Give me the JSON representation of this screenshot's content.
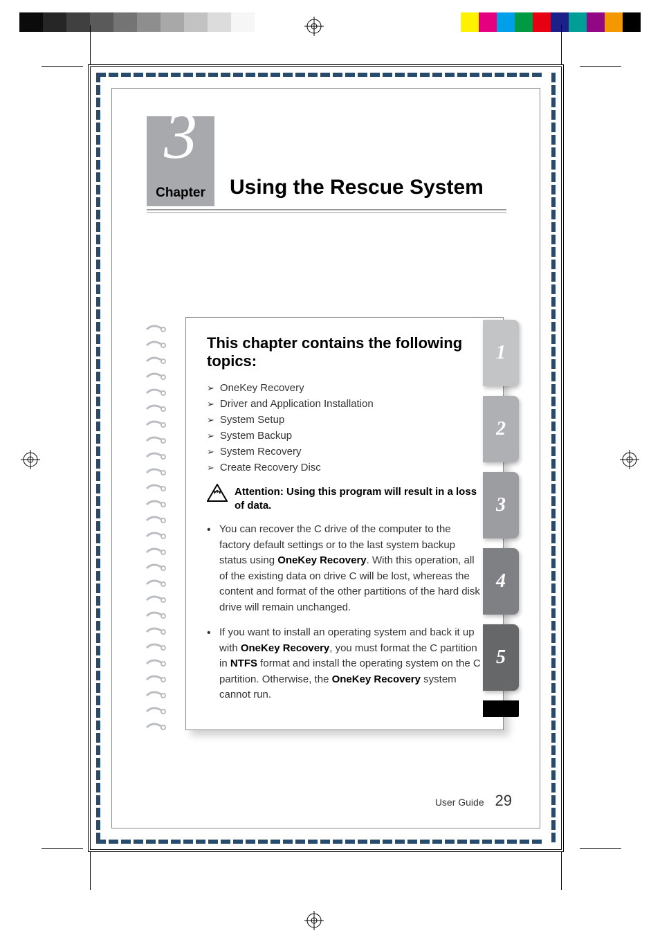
{
  "colorbars_left": [
    "#0b0b0b",
    "#262626",
    "#404040",
    "#5a5a5a",
    "#747474",
    "#8e8e8e",
    "#a8a8a8",
    "#c2c2c2",
    "#dcdcdc",
    "#f6f6f6"
  ],
  "colorbars_right": [
    "#fff200",
    "#e4007f",
    "#00a0e9",
    "#009944",
    "#e60012",
    "#1d2088",
    "#009e96",
    "#920783",
    "#f39800",
    "#000000"
  ],
  "chapter": {
    "number": "3",
    "label": "Chapter",
    "title": "Using the Rescue System"
  },
  "topics": {
    "heading": "This chapter contains the following topics:",
    "items": [
      "OneKey Recovery",
      "Driver and Application Installation",
      "System Setup",
      "System Backup",
      "System Recovery",
      "Create Recovery Disc"
    ],
    "attention": "Attention: Using this program will result in a loss of data.",
    "bullets": [
      {
        "pre": "You can recover the C drive of the computer to the factory default settings or to the last system backup status using ",
        "b1": "OneKey Recovery",
        "mid": ". With this operation, all of the existing data on drive C will be lost, whereas the content and format of the other partitions of the hard disk drive will remain unchanged.",
        "b2": "",
        "mid2": "",
        "b3": "",
        "post": ""
      },
      {
        "pre": "If you want to install an operating system and back it up with ",
        "b1": "OneKey Recovery",
        "mid": ", you must format the C partition in ",
        "b2": "NTFS",
        "mid2": " format and install the operating system on the C partition. Otherwise, the ",
        "b3": "OneKey Recovery",
        "post": " system cannot run."
      }
    ]
  },
  "tabs": [
    "1",
    "2",
    "3",
    "4",
    "5"
  ],
  "footer": {
    "label": "User Guide",
    "page": "29"
  }
}
